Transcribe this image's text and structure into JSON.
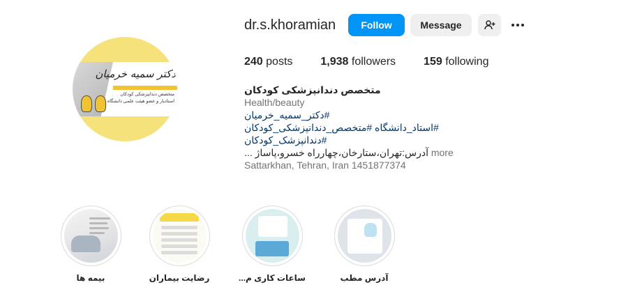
{
  "profile": {
    "username": "dr.s.khoramian",
    "follow_label": "Follow",
    "message_label": "Message",
    "stats": {
      "posts_count": "240",
      "posts_label": "posts",
      "followers_count": "1,938",
      "followers_label": "followers",
      "following_count": "159",
      "following_label": "following"
    },
    "bio": {
      "name": "متخصص دندانپزشکی کودکان",
      "category": "Health/beauty",
      "line1": "#دکتر_سمیه_خرمیان",
      "line2": "#استاد_دانشگاه #متخصص_دندانپزشکی_کودکان",
      "line3": "#دندانپزشک_کودکان",
      "line4": "آدرس:تهران،ستارخان،چهارراه خسرو،پاساژ ...",
      "more_label": "more",
      "location": "Sattarkhan, Tehran, Iran 1451877374"
    },
    "avatar": {
      "logo_text": "دکتر سمیه خرمیان",
      "sub_line1": "متخصص دندانپزشکی کودکان",
      "sub_line2": "استادیار و عضو هیئت علمی دانشگاه"
    }
  },
  "highlights": [
    {
      "label": "بیمه ها"
    },
    {
      "label": "رضایت بیماران"
    },
    {
      "label": "ساعات کاری م..."
    },
    {
      "label": "آدرس مطب"
    }
  ],
  "colors": {
    "accent": "#0095f6",
    "secondary_button": "#efefef",
    "hashtag": "#00376b",
    "muted": "#737373",
    "avatar_yellow": "#f6e27a"
  },
  "icons": {
    "add_user": "person-add-icon",
    "more": "more-horizontal-icon"
  }
}
